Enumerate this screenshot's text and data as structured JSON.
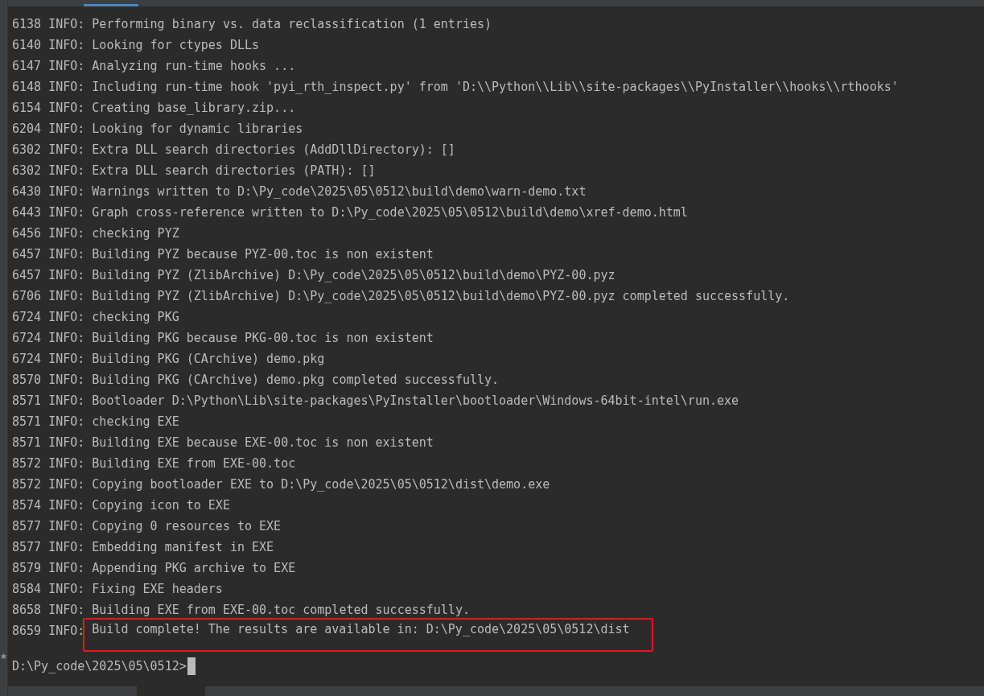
{
  "log_lines": [
    {
      "prefix": "6138 INFO:",
      "message": "Performing binary vs. data reclassification (1 entries)",
      "highlighted": false
    },
    {
      "prefix": "6140 INFO:",
      "message": "Looking for ctypes DLLs",
      "highlighted": false
    },
    {
      "prefix": "6147 INFO:",
      "message": "Analyzing run-time hooks ...",
      "highlighted": false
    },
    {
      "prefix": "6148 INFO:",
      "message": "Including run-time hook 'pyi_rth_inspect.py' from 'D:\\\\Python\\\\Lib\\\\site-packages\\\\PyInstaller\\\\hooks\\\\rthooks'",
      "highlighted": false
    },
    {
      "prefix": "6154 INFO:",
      "message": "Creating base_library.zip...",
      "highlighted": false
    },
    {
      "prefix": "6204 INFO:",
      "message": "Looking for dynamic libraries",
      "highlighted": false
    },
    {
      "prefix": "6302 INFO:",
      "message": "Extra DLL search directories (AddDllDirectory): []",
      "highlighted": false
    },
    {
      "prefix": "6302 INFO:",
      "message": "Extra DLL search directories (PATH): []",
      "highlighted": false
    },
    {
      "prefix": "6430 INFO:",
      "message": "Warnings written to D:\\Py_code\\2025\\05\\0512\\build\\demo\\warn-demo.txt",
      "highlighted": false
    },
    {
      "prefix": "6443 INFO:",
      "message": "Graph cross-reference written to D:\\Py_code\\2025\\05\\0512\\build\\demo\\xref-demo.html",
      "highlighted": false
    },
    {
      "prefix": "6456 INFO:",
      "message": "checking PYZ",
      "highlighted": false
    },
    {
      "prefix": "6457 INFO:",
      "message": "Building PYZ because PYZ-00.toc is non existent",
      "highlighted": false
    },
    {
      "prefix": "6457 INFO:",
      "message": "Building PYZ (ZlibArchive) D:\\Py_code\\2025\\05\\0512\\build\\demo\\PYZ-00.pyz",
      "highlighted": false
    },
    {
      "prefix": "6706 INFO:",
      "message": "Building PYZ (ZlibArchive) D:\\Py_code\\2025\\05\\0512\\build\\demo\\PYZ-00.pyz completed successfully.",
      "highlighted": false
    },
    {
      "prefix": "6724 INFO:",
      "message": "checking PKG",
      "highlighted": false
    },
    {
      "prefix": "6724 INFO:",
      "message": "Building PKG because PKG-00.toc is non existent",
      "highlighted": false
    },
    {
      "prefix": "6724 INFO:",
      "message": "Building PKG (CArchive) demo.pkg",
      "highlighted": false
    },
    {
      "prefix": "8570 INFO:",
      "message": "Building PKG (CArchive) demo.pkg completed successfully.",
      "highlighted": false
    },
    {
      "prefix": "8571 INFO:",
      "message": "Bootloader D:\\Python\\Lib\\site-packages\\PyInstaller\\bootloader\\Windows-64bit-intel\\run.exe",
      "highlighted": false
    },
    {
      "prefix": "8571 INFO:",
      "message": "checking EXE",
      "highlighted": false
    },
    {
      "prefix": "8571 INFO:",
      "message": "Building EXE because EXE-00.toc is non existent",
      "highlighted": false
    },
    {
      "prefix": "8572 INFO:",
      "message": "Building EXE from EXE-00.toc",
      "highlighted": false
    },
    {
      "prefix": "8572 INFO:",
      "message": "Copying bootloader EXE to D:\\Py_code\\2025\\05\\0512\\dist\\demo.exe",
      "highlighted": false
    },
    {
      "prefix": "8574 INFO:",
      "message": "Copying icon to EXE",
      "highlighted": false
    },
    {
      "prefix": "8577 INFO:",
      "message": "Copying 0 resources to EXE",
      "highlighted": false
    },
    {
      "prefix": "8577 INFO:",
      "message": "Embedding manifest in EXE",
      "highlighted": false
    },
    {
      "prefix": "8579 INFO:",
      "message": "Appending PKG archive to EXE",
      "highlighted": false
    },
    {
      "prefix": "8584 INFO:",
      "message": "Fixing EXE headers",
      "highlighted": false
    },
    {
      "prefix": "8658 INFO:",
      "message": "Building EXE from EXE-00.toc completed successfully.",
      "highlighted": false
    },
    {
      "prefix": "8659 INFO:",
      "message": "Build complete! The results are available in: D:\\Py_code\\2025\\05\\0512\\dist",
      "highlighted": true
    }
  ],
  "prompt": "D:\\Py_code\\2025\\05\\0512>"
}
